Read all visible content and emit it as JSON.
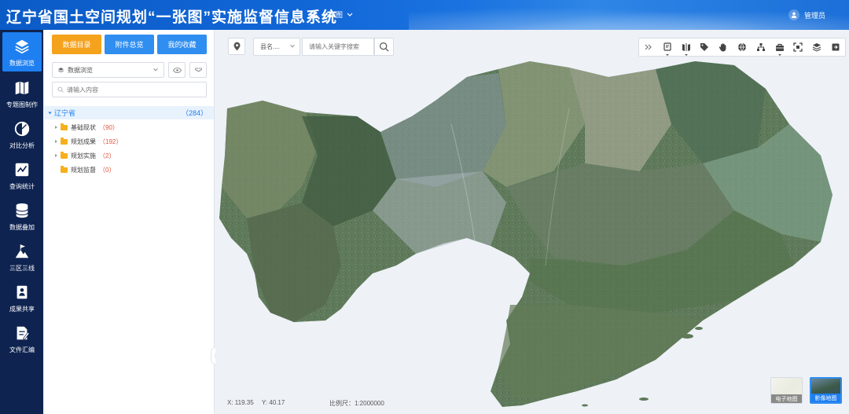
{
  "header": {
    "title": "辽宁省国土空间规划“一张图”实施监督信息系统",
    "menu_label": "一张图",
    "user_label": "管理员"
  },
  "leftnav": {
    "items": [
      {
        "label": "数据浏览",
        "icon": "layers-icon",
        "active": true
      },
      {
        "label": "专题图制作",
        "icon": "map-book-icon",
        "active": false
      },
      {
        "label": "对比分析",
        "icon": "contrast-icon",
        "active": false
      },
      {
        "label": "查询统计",
        "icon": "chart-line-icon",
        "active": false
      },
      {
        "label": "数据叠加",
        "icon": "database-icon",
        "active": false
      },
      {
        "label": "三区三线",
        "icon": "mountain-flag-icon",
        "active": false
      },
      {
        "label": "成果共享",
        "icon": "id-card-icon",
        "active": false
      },
      {
        "label": "文件汇编",
        "icon": "document-edit-icon",
        "active": false
      }
    ]
  },
  "panel": {
    "tabs": [
      "数据目录",
      "附件总览",
      "我的收藏"
    ],
    "select_value": "数据浏览",
    "search_placeholder": "请输入内容",
    "tree": {
      "root_label": "辽宁省",
      "root_count": "（284）",
      "items": [
        {
          "label": "基础现状",
          "count": "（90）",
          "expandable": true
        },
        {
          "label": "规划成果",
          "count": "（192）",
          "expandable": true
        },
        {
          "label": "规划实施",
          "count": "（2）",
          "expandable": true
        },
        {
          "label": "规划监督",
          "count": "（0）",
          "expandable": false
        }
      ]
    }
  },
  "map": {
    "region_select": "县名....",
    "keyword_placeholder": "请输入关键字搜索",
    "toolbar_icons": [
      "expand-double-chevron-icon",
      "measure-icon",
      "split-screen-icon",
      "tag-icon",
      "pan-hand-icon",
      "globe-icon",
      "network-tree-icon",
      "toolbox-icon",
      "fullscreen-icon",
      "layer-stack-icon",
      "export-icon"
    ],
    "coord_x_label": "X:",
    "coord_x": "119.35",
    "coord_y_label": "Y:",
    "coord_y": "40.17",
    "scale_label": "比例尺：",
    "scale_value": "1:2000000",
    "basemaps": [
      {
        "label": "电子地图",
        "selected": false
      },
      {
        "label": "影像地图",
        "selected": true
      }
    ]
  },
  "colors": {
    "header_blue": "#1166d6",
    "nav_dark": "#0e2350",
    "accent": "#1e7ff0",
    "orange": "#f5a21c"
  }
}
